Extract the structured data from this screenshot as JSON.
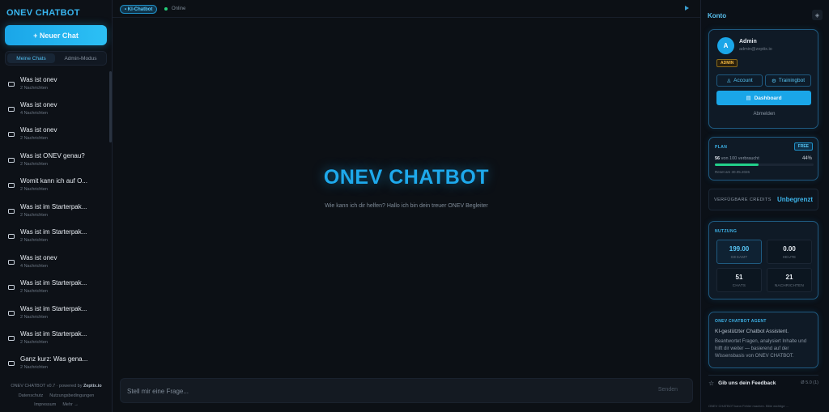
{
  "sidebar": {
    "brand": "ONEV CHATBOT",
    "new_chat": "+ Neuer Chat",
    "tabs": [
      "Meine Chats",
      "Admin-Modus"
    ],
    "chats": [
      {
        "title": "Was ist onev",
        "sub": "2 Nachrichten"
      },
      {
        "title": "Was ist onev",
        "sub": "4 Nachrichten"
      },
      {
        "title": "Was ist onev",
        "sub": "2 Nachrichten"
      },
      {
        "title": "Was ist ONEV genau?",
        "sub": "2 Nachrichten"
      },
      {
        "title": "Womit kann ich auf O...",
        "sub": "2 Nachrichten"
      },
      {
        "title": "Was ist im Starterpak...",
        "sub": "2 Nachrichten"
      },
      {
        "title": "Was ist im Starterpak...",
        "sub": "2 Nachrichten"
      },
      {
        "title": "Was ist onev",
        "sub": "4 Nachrichten"
      },
      {
        "title": "Was ist im Starterpak...",
        "sub": "2 Nachrichten"
      },
      {
        "title": "Was ist im Starterpak...",
        "sub": "2 Nachrichten"
      },
      {
        "title": "Was ist im Starterpak...",
        "sub": "2 Nachrichten"
      },
      {
        "title": "Ganz kurz: Was gena...",
        "sub": "2 Nachrichten"
      }
    ],
    "footer": {
      "version": "ONEV CHATBOT v0.7 · powered by",
      "powered": "Zeptix.io",
      "links_row1": [
        "Datenschutz",
        "Nutzungsbedingungen"
      ],
      "links_row2": [
        "Impressum",
        "Mehr →"
      ]
    }
  },
  "header": {
    "pill": "• KI-Chatbot",
    "status": "Online"
  },
  "hero": {
    "title": "ONEV CHATBOT",
    "subtitle": "Wie kann ich dir helfen? Hallo ich bin dein treuer ONEV Begleiter"
  },
  "composer": {
    "placeholder": "Stell mir eine Frage...",
    "send": "Senden"
  },
  "account": {
    "panel_title": "Konto",
    "avatar_letter": "A",
    "name": "Admin",
    "email": "admin@zeptix.io",
    "role_badge": "ADMIN",
    "account_btn": "Account",
    "trainingbot_btn": "Trainingbot",
    "dashboard_btn": "Dashboard",
    "logout": "Abmelden"
  },
  "plan": {
    "label": "PLAN",
    "badge": "FREE",
    "used_num": "56",
    "used_rest": "von 100 verbraucht",
    "percent_label": "44%",
    "progress": 0.44,
    "reset": "Reset am 30.05.2026"
  },
  "credits": {
    "label": "VERFÜGBARE CREDITS",
    "value": "Unbegrenzt"
  },
  "usage": {
    "label": "NUTZUNG",
    "stats": [
      {
        "value": "199.00",
        "label": "GESAMT"
      },
      {
        "value": "0.00",
        "label": "HEUTE"
      },
      {
        "value": "51",
        "label": "CHATS"
      },
      {
        "value": "21",
        "label": "NACHRICHTEN"
      }
    ]
  },
  "agent": {
    "label": "ONEV CHATBOT AGENT",
    "subtitle": "KI-gestützter Chatbot Assistent.",
    "description": "Beantwortet Fragen, analysiert Inhalte und hilft dir weiter — basierend auf der Wissensbasis von ONEV CHATBOT."
  },
  "feedback": {
    "label": "Gib uns dein Feedback",
    "rating": "Ø 5.0 (1)"
  },
  "panel_footer": "ONEV CHATBOT kann Fehler machen. Bitte wichtige ..."
}
